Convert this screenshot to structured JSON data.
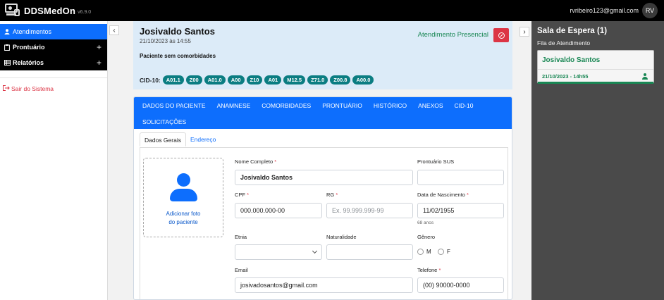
{
  "app": {
    "brand": "DDSMedOn",
    "version": "v6.9.0",
    "user_email": "rvribeiro123@gmail.com",
    "user_initials": "RV"
  },
  "sidebar": {
    "items": [
      {
        "label": "Atendimentos",
        "icon": "user-icon",
        "active": true
      },
      {
        "label": "Prontuário",
        "icon": "clipboard-icon",
        "expandable": true
      },
      {
        "label": "Relatórios",
        "icon": "table-icon",
        "expandable": true
      }
    ],
    "logout_label": "Sair do Sistema"
  },
  "arrows": {
    "left": "‹",
    "right": "›"
  },
  "patient": {
    "name": "Josivaldo Santos",
    "datetime": "21/10/2023 às 14:55",
    "comorbidity": "Paciente sem comorbidades",
    "attendance_type": "Atendimento Presencial",
    "cid_label": "CID-10:",
    "cid_codes": [
      "A01.1",
      "Z00",
      "A01.0",
      "A00",
      "Z10",
      "A01",
      "M12.5",
      "Z71.0",
      "Z00.8",
      "A00.0"
    ]
  },
  "tabs": [
    "DADOS DO PACIENTE",
    "ANAMNESE",
    "COMORBIDADES",
    "PRONTUÁRIO",
    "HISTÓRICO",
    "ANEXOS",
    "CID-10",
    "SOLICITAÇÕES"
  ],
  "subtabs": [
    "Dados Gerais",
    "Endereço"
  ],
  "photo": {
    "line1": "Adicionar foto",
    "line2": "do paciente"
  },
  "form": {
    "nome_label": "Nome Completo",
    "nome_value": "Josivaldo Santos",
    "sus_label": "Prontuário SUS",
    "sus_value": "",
    "cpf_label": "CPF",
    "cpf_value": "000.000.000-00",
    "rg_label": "RG",
    "rg_placeholder": "Ex. 99.999.999-99",
    "nasc_label": "Data de Nascimento",
    "nasc_value": "11/02/1955",
    "age_hint": "68 anos",
    "etnia_label": "Etnia",
    "etnia_value": "",
    "natural_label": "Naturalidade",
    "natural_value": "",
    "genero_label": "Gênero",
    "genero_options": [
      "M",
      "F"
    ],
    "email_label": "Email",
    "email_value": "josivadosantos@gmail.com",
    "telefone_label": "Telefone",
    "telefone_value": "(00) 90000-0000",
    "required_mark": "*"
  },
  "waiting_room": {
    "title": "Sala de Espera (1)",
    "subtitle": "Fila de Atendimento",
    "patients": [
      {
        "name": "Josivaldo Santos",
        "time": "21/10/2023 - 14h55"
      }
    ]
  },
  "colors": {
    "primary": "#0d6efd",
    "success": "#198754",
    "danger": "#dc3545",
    "cid_badge": "#0b7d82",
    "patient_card_bg": "#dcebf8",
    "waiting_bg": "#4a4a4a"
  }
}
